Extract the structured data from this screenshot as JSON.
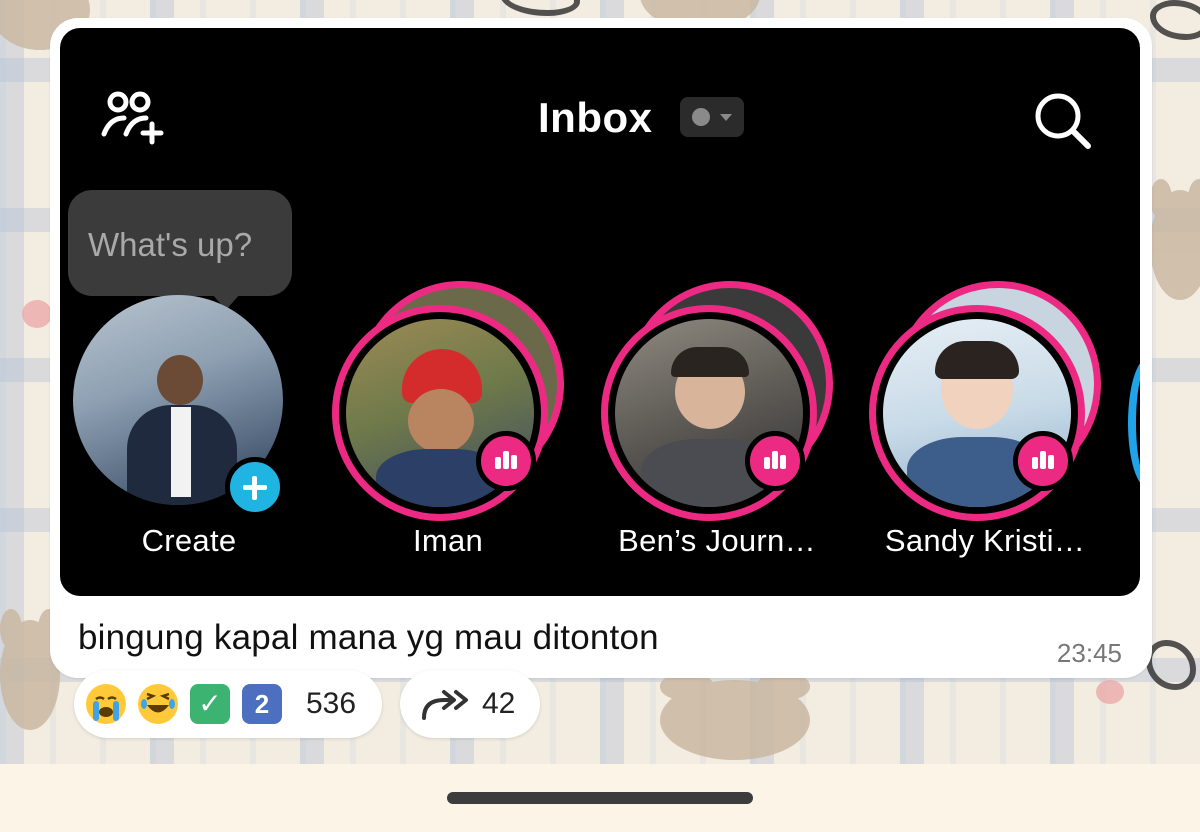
{
  "shared_screenshot": {
    "header": {
      "title": "Inbox",
      "add_friends_icon": "person-add-icon",
      "search_icon": "search-icon",
      "status_icon": "status-dropdown-icon"
    },
    "tooltip": {
      "text": "What's up?"
    },
    "stories": [
      {
        "label": "Create",
        "type": "create",
        "badge_icon": "plus-icon",
        "accent": "#20b4e3"
      },
      {
        "label": "Iman",
        "type": "story",
        "badge_icon": "live-bars-icon",
        "accent": "#ec2a83"
      },
      {
        "label": "Ben’s Journ…",
        "type": "story",
        "badge_icon": "live-bars-icon",
        "accent": "#ec2a83"
      },
      {
        "label": "Sandy Kristi…",
        "type": "story",
        "badge_icon": "live-bars-icon",
        "accent": "#ec2a83"
      }
    ]
  },
  "message": {
    "caption": "bingung kapal mana yg mau ditonton",
    "time": "23:45"
  },
  "reactions": {
    "emojis": [
      "crying-face",
      "laughing-face",
      "check-mark",
      "keycap-2"
    ],
    "check_glyph": "✓",
    "two_glyph": "2",
    "count": "536"
  },
  "forward": {
    "icon": "forward-arrows-icon",
    "count": "42"
  },
  "colors": {
    "story_ring": "#ec2a83",
    "create_badge": "#20b4e3",
    "bubble": "#ffffff",
    "screenshot_bg": "#000000"
  }
}
